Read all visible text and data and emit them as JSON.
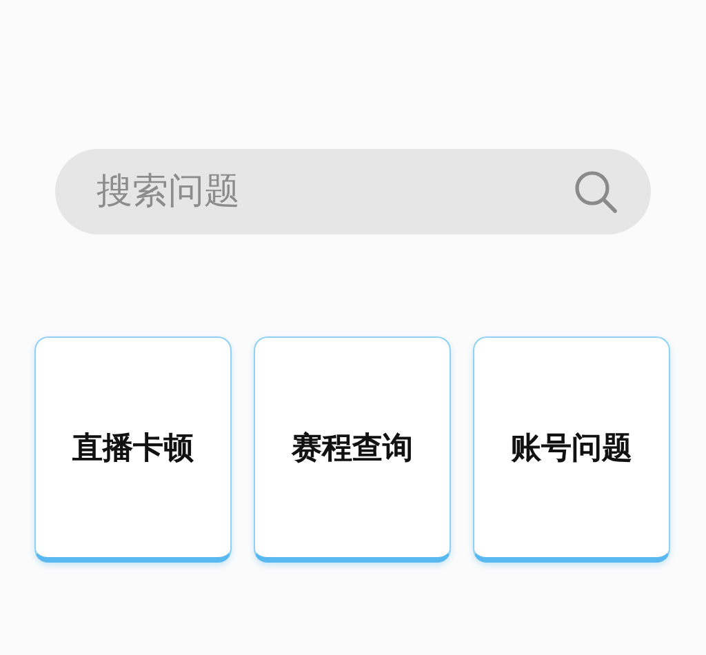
{
  "search": {
    "placeholder": "搜索问题"
  },
  "topics": [
    {
      "label": "直播卡顿"
    },
    {
      "label": "赛程查询"
    },
    {
      "label": "账号问题"
    }
  ]
}
